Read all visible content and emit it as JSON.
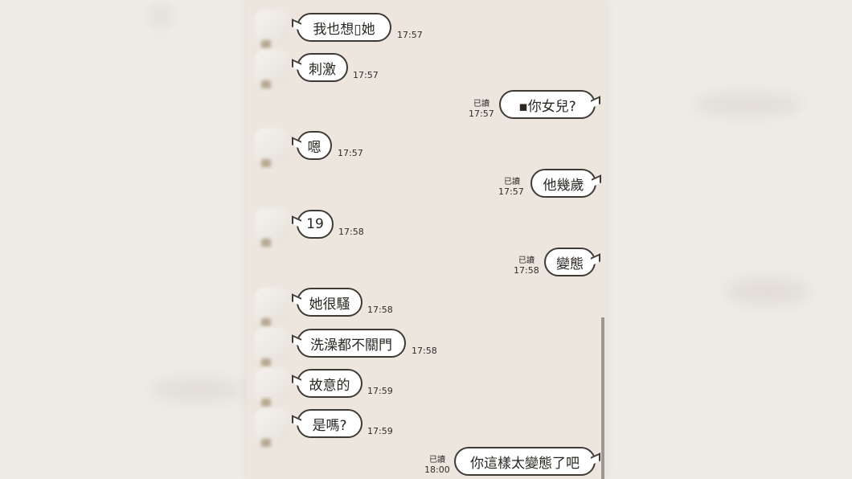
{
  "chat": {
    "messages": [
      {
        "side": "in",
        "text": "我也想▯她",
        "time": "17:57"
      },
      {
        "side": "in",
        "text": "刺激",
        "time": "17:57"
      },
      {
        "side": "out",
        "text": "▪你女兒?",
        "time": "17:57",
        "read": "已讀"
      },
      {
        "side": "in",
        "text": "嗯",
        "time": "17:57"
      },
      {
        "side": "out",
        "text": "他幾歲",
        "time": "17:57",
        "read": "已讀"
      },
      {
        "side": "in",
        "text": "19",
        "time": "17:58"
      },
      {
        "side": "out",
        "text": "變態",
        "time": "17:58",
        "read": "已讀"
      },
      {
        "side": "in",
        "text": "她很騷",
        "time": "17:58"
      },
      {
        "side": "in",
        "text": "洗澡都不關門",
        "time": "17:58"
      },
      {
        "side": "in",
        "text": "故意的",
        "time": "17:59"
      },
      {
        "side": "in",
        "text": "是嗎?",
        "time": "17:59"
      },
      {
        "side": "out",
        "text": "你這樣太變態了吧",
        "time": "18:00",
        "read": "已讀"
      }
    ]
  }
}
